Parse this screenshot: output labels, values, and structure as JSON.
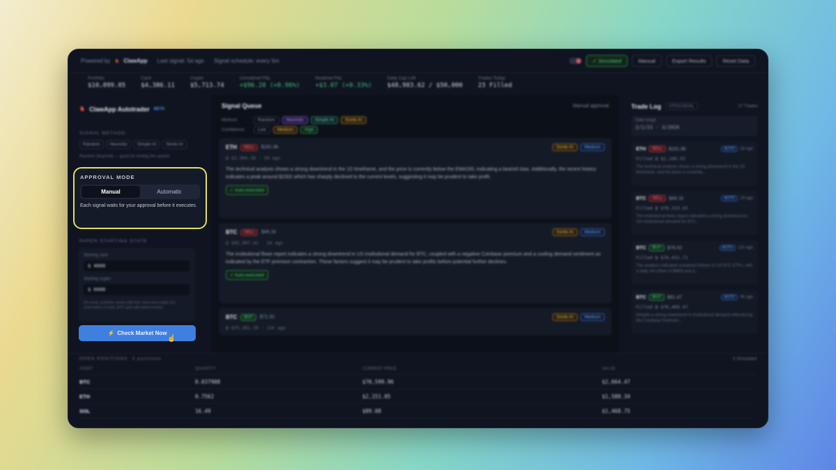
{
  "topbar": {
    "powered_by": "Powered by",
    "brand": "ClawApp",
    "last_signal": "Last signal: 5d ago",
    "schedule": "Signal schedule: every 5m",
    "simulated_label": "✓ Simulated",
    "manual_label": "Manual",
    "export_label": "Export Results",
    "reset_label": "Reset Data"
  },
  "stats": [
    {
      "label": "Portfolio",
      "value": "$10,099.05",
      "tone": "neutral"
    },
    {
      "label": "Cash",
      "value": "$4,386.11",
      "tone": "neutral"
    },
    {
      "label": "Crypto",
      "value": "$5,713.74",
      "tone": "neutral"
    },
    {
      "label": "Unrealized P&L",
      "value": "+$96.28 (+0.96%)",
      "tone": "green"
    },
    {
      "label": "Realized P&L",
      "value": "+$3.07 (+0.33%)",
      "tone": "green"
    },
    {
      "label": "Daily Cap Left",
      "value": "$48,983.62 / $50,000",
      "tone": "neutral"
    },
    {
      "label": "Trades Today",
      "value": "23 Filled",
      "tone": "neutral"
    }
  ],
  "sidebar": {
    "title": "ClawApp Autotrader",
    "beta": "BETA",
    "signal_method_label": "SIGNAL METHOD",
    "methods": [
      "Random",
      "Heuristic",
      "Simple AI",
      "Sonle AI"
    ],
    "method_note": "Random (buy/sell) — good for testing the system",
    "approval": {
      "title": "APPROVAL MODE",
      "manual": "Manual",
      "automatic": "Automatic",
      "description": "Each signal waits for your approval before it executes."
    },
    "paper_label": "PAPER STARTING STATE",
    "paper": {
      "cash_label": "Starting cash",
      "cash_value": "$ 4000",
      "crypto_label": "Starting crypto",
      "crypto_value": "$ 6000",
      "note": "On reset, portfolio resets with this cash and crypto (no reservation is held, BTC gets allocated evenly)."
    },
    "check_button": "Check Market Now"
  },
  "queue": {
    "title": "Signal Queue",
    "mode": "Manual approval",
    "method_label": "Method",
    "methods": [
      "Random",
      "Heuristic",
      "Simple AI",
      "Sonle AI"
    ],
    "confidence_label": "Confidence",
    "confidence": [
      "Low",
      "Medium",
      "High"
    ],
    "cards": [
      {
        "symbol": "ETH",
        "side": "SELL",
        "amount": "$181.8k",
        "tag1": "Sonle AI",
        "tag2": "Medium",
        "meta": "@ $2,304.28 · 3d ago",
        "text": "The technical analysis shows a strong downtrend in the 1D timeframe, and the price is currently below the EMA200, indicating a bearish bias. Additionally, the recent history indicates a peak around $2302 which has sharply declined to the current levels, suggesting it may be prudent to take profit.",
        "exec": "✓ Auto-executed"
      },
      {
        "symbol": "BTC",
        "side": "SELL",
        "amount": "$46.1k",
        "tag1": "Sonle AI",
        "tag2": "Medium",
        "meta": "@ $95,907.42 · 2d ago",
        "text": "The institutional flows report indicates a strong downtrend in US institutional demand for BTC, coupled with a negative Coinbase premium and a cooling demand sentiment as indicated by the ETF premium contraction. These factors suggest it may be prudent to take profits before potential further declines.",
        "exec": "✓ Auto-executed"
      },
      {
        "symbol": "BTC",
        "side": "BUY",
        "amount": "$71.32",
        "tag1": "Sonle AI",
        "tag2": "Medium",
        "meta": "@ $75,361.39 · 11h ago",
        "text": "",
        "exec": ""
      }
    ]
  },
  "tradelog": {
    "title": "Trade Log",
    "timezone": "UTC/LOCAL",
    "count": "17 Trades",
    "search_label": "Date range",
    "search_value": "2/1/21 - 3/2026",
    "items": [
      {
        "symbol": "ETH",
        "side": "SELL",
        "amount": "$181.8k",
        "auto": "AUTO",
        "ago": "3d ago",
        "fill": "Filled @ $2,149.33",
        "desc": "The technical analysis shows a strong downtrend in the 1D timeframe, and the price is currently..."
      },
      {
        "symbol": "BTC",
        "side": "SELL",
        "amount": "$46.1k",
        "auto": "AUTO",
        "ago": "2d ago",
        "fill": "Filled @ $76,319.43",
        "desc": "The institutional flows report indicated a strong downtrend in US institutional demand for BTC..."
      },
      {
        "symbol": "BTC",
        "side": "BUY",
        "amount": "$76.02",
        "auto": "AUTO",
        "ago": "11h ago",
        "fill": "Filled @ $76,431.71",
        "desc": "The analysis indicated sustained inflows to US BTC ETFs, with a daily net inflow of $86M and a..."
      },
      {
        "symbol": "BTC",
        "side": "BUY",
        "amount": "$61.47",
        "auto": "AUTO",
        "ago": "9h ago",
        "fill": "Filled @ $76,469.47",
        "desc": "Despite a strong downtrend in institutional demand reflected by the Coinbase Premium..."
      }
    ]
  },
  "positions": {
    "title": "OPEN POSITIONS",
    "count": "3 positions",
    "filter": "3 Simulated",
    "columns": [
      "ASSET",
      "QUANTITY",
      "CURRENT PRICE",
      "VALUE"
    ],
    "rows": [
      {
        "asset": "BTC",
        "qty": "0.037908",
        "price": "$70,599.96",
        "value": "$2,664.47"
      },
      {
        "asset": "ETH",
        "qty": "0.7562",
        "price": "$2,151.05",
        "value": "$1,588.34"
      },
      {
        "asset": "SOL",
        "qty": "16.49",
        "price": "$89.08",
        "value": "$1,468.75"
      }
    ]
  }
}
